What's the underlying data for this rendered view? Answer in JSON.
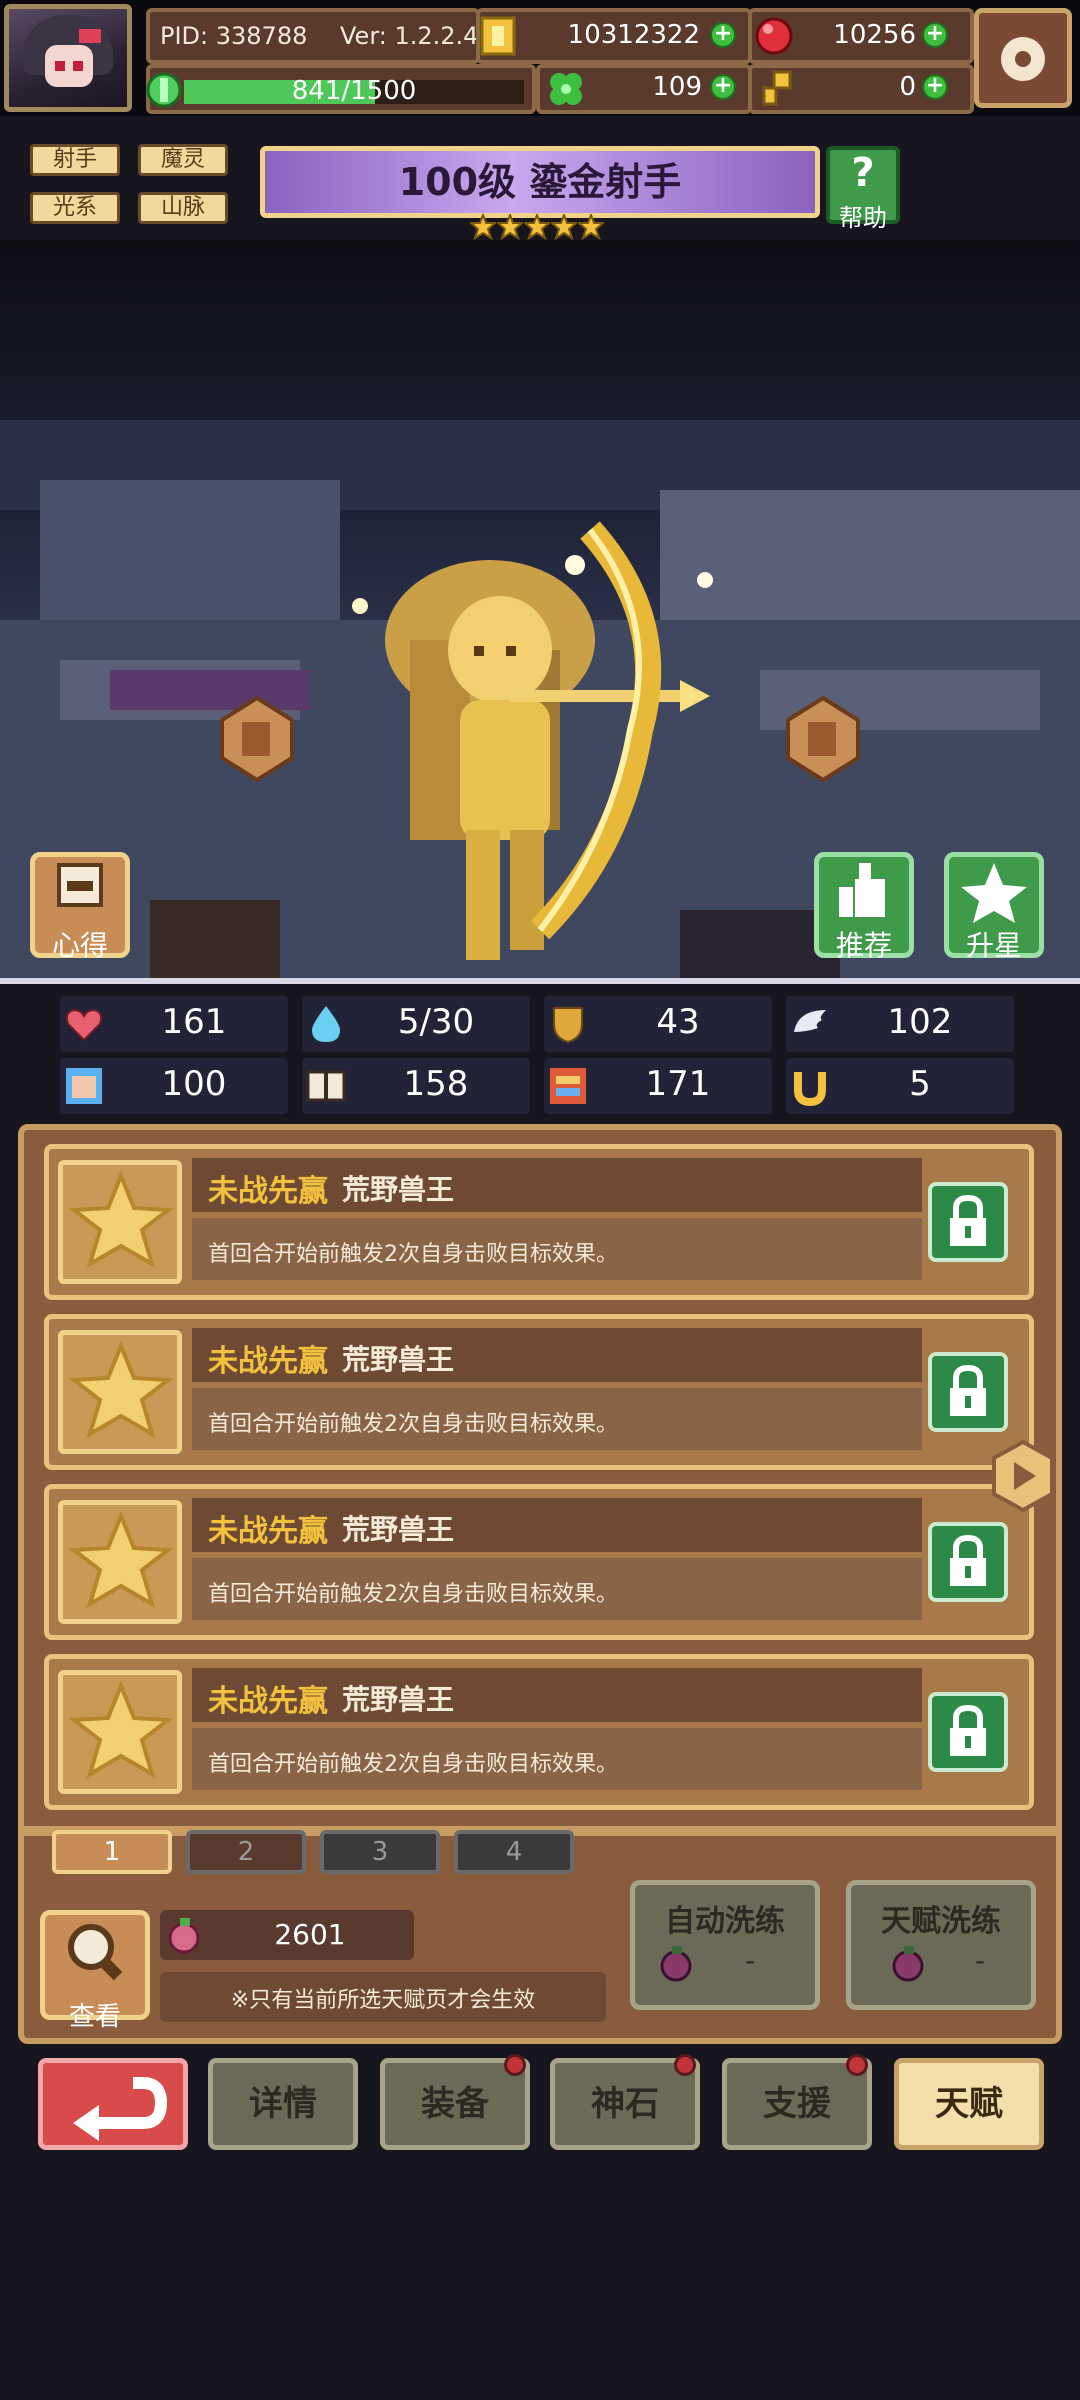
{
  "header": {
    "pid": "PID: 338788",
    "version": "Ver: 1.2.2.4",
    "gold": "10312322",
    "gems": "10256",
    "clover": "109",
    "key": "0",
    "exp": "841/1500"
  },
  "hero": {
    "tags": [
      "射手",
      "魔灵",
      "光系",
      "山脉"
    ],
    "title": "100级  鎏金射手",
    "stars": 5,
    "help_label": "帮助"
  },
  "scene": {
    "left_button": "心得",
    "recommend_button": "推荐",
    "star_up_button": "升星"
  },
  "stats": [
    {
      "icon": "heart-icon",
      "value": "161"
    },
    {
      "icon": "water-drop-icon",
      "value": "5/30"
    },
    {
      "icon": "shield-icon",
      "value": "43"
    },
    {
      "icon": "wing-icon",
      "value": "102"
    },
    {
      "icon": "fist-icon",
      "value": "100"
    },
    {
      "icon": "book-icon",
      "value": "158"
    },
    {
      "icon": "scroll-icon",
      "value": "171"
    },
    {
      "icon": "horseshoe-icon",
      "value": "5"
    }
  ],
  "talents": [
    {
      "name": "未战先赢",
      "sub": "荒野兽王",
      "desc": "首回合开始前触发2次自身击败目标效果。"
    },
    {
      "name": "未战先赢",
      "sub": "荒野兽王",
      "desc": "首回合开始前触发2次自身击败目标效果。"
    },
    {
      "name": "未战先赢",
      "sub": "荒野兽王",
      "desc": "首回合开始前触发2次自身击败目标效果。"
    },
    {
      "name": "未战先赢",
      "sub": "荒野兽王",
      "desc": "首回合开始前触发2次自身击败目标效果。"
    }
  ],
  "talent_tabs": [
    "1",
    "2",
    "3",
    "4"
  ],
  "talent_footer": {
    "view_label": "查看",
    "resource_count": "2601",
    "note": "※只有当前所选天赋页才会生效",
    "auto_refine_label": "自动洗练",
    "auto_refine_cost": "-",
    "talent_refine_label": "天赋洗练",
    "talent_refine_cost": "-"
  },
  "nav": {
    "back": "",
    "details": "详情",
    "equipment": "装备",
    "godstone": "神石",
    "support": "支援",
    "talent": "天赋"
  },
  "colors": {
    "accent_gold": "#f2c13d",
    "panel_brown": "#8a5c3e",
    "title_purple": "#a07ad4",
    "lock_green": "#2a8a46",
    "back_red": "#d94a4a"
  }
}
